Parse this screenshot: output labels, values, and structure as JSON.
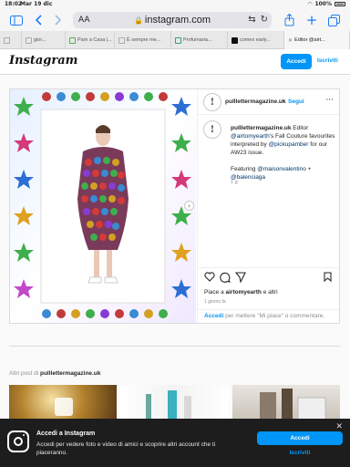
{
  "status_bar": {
    "time": "18:02",
    "date": "Mar 19 dic",
    "battery": "100%"
  },
  "browser": {
    "text_size_label": "AA",
    "url": "instagram.com",
    "tabs": [
      {
        "label": ""
      },
      {
        "label": "gior..."
      },
      {
        "label": "Pam a Casa |..."
      },
      {
        "label": "È sempre me..."
      },
      {
        "label": "Profumaria..."
      },
      {
        "label": "comes early..."
      },
      {
        "label": "Editor @airt..."
      }
    ]
  },
  "ig_header": {
    "logo": "Instagram",
    "login_button": "Accedi",
    "signup_link": "Iscriviti"
  },
  "post": {
    "username": "pulllettermagazine.uk",
    "separator": "•",
    "follow_label": "Segui",
    "avatar_letter": "!",
    "caption": {
      "username": "pulllettermagazine.uk",
      "intro": "Editor",
      "mention1": "@airtomyearth",
      "text1": "'s Fall Couture favourites interpreted by",
      "mention2": "@pickupamber",
      "text2": "for our AW23 issue.",
      "featuring": "Featuring",
      "mention3": "@maisonvalentino",
      "plus": "+",
      "mention4": "@balenciaga",
      "time": "1 g"
    },
    "likes_prefix": "Piace a",
    "likes_user": "airtomyearth",
    "likes_suffix": "e altri",
    "time": "1 giorno fa",
    "login_prompt_link": "Accedi",
    "login_prompt_text": "per mettere \"Mi piace\" o commentare."
  },
  "more_posts": {
    "prefix": "Altri post di",
    "username": "pulllettermagazine.uk"
  },
  "banner": {
    "title": "Accedi a Instagram",
    "text": "Accedi per vedere foto e video di amici e scoprire altri account che ti piaceranno.",
    "login_button": "Accedi",
    "signup_link": "Iscriviti"
  },
  "colors": {
    "brand_blue": "#0095f6",
    "safari_blue": "#1e7cf2",
    "banner_bg": "#1d1d1d"
  },
  "icons": [
    "sidebar-icon",
    "back-icon",
    "forward-icon",
    "lock-icon",
    "translate-icon",
    "reload-icon",
    "share-icon",
    "new-tab-icon",
    "tabs-icon",
    "heart-icon",
    "comment-icon",
    "send-icon",
    "bookmark-icon",
    "more-icon",
    "close-icon",
    "instagram-icon"
  ]
}
